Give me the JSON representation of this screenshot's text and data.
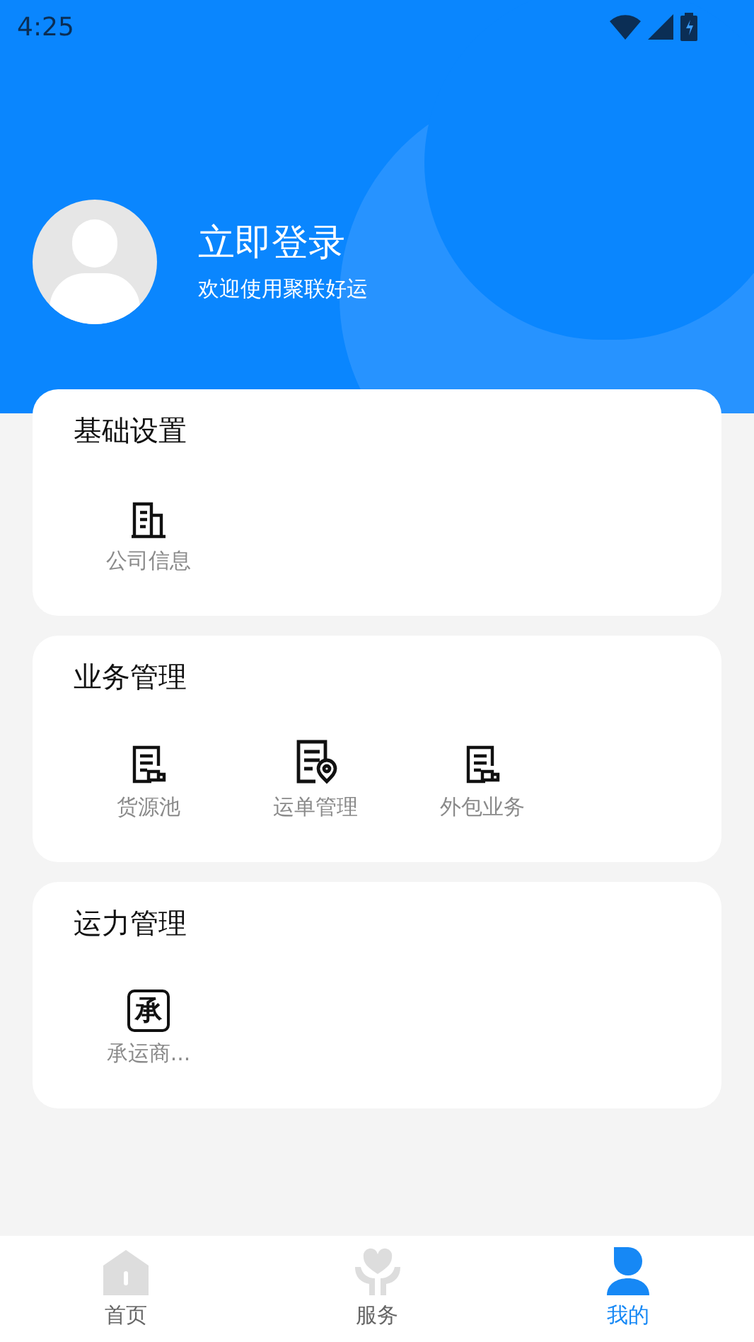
{
  "status_bar": {
    "time": "4:25"
  },
  "profile": {
    "title": "立即登录",
    "subtitle": "欢迎使用聚联好运"
  },
  "sections": [
    {
      "title": "基础设置",
      "items": [
        {
          "label": "公司信息",
          "kind": "building"
        }
      ]
    },
    {
      "title": "业务管理",
      "items": [
        {
          "label": "货源池",
          "kind": "doc-truck"
        },
        {
          "label": "运单管理",
          "kind": "doc-pin"
        },
        {
          "label": "外包业务",
          "kind": "doc-truck"
        }
      ]
    },
    {
      "title": "运力管理",
      "items": [
        {
          "label": "承运商...",
          "kind": "glyph",
          "glyph": "承"
        }
      ]
    }
  ],
  "tabs": [
    {
      "label": "首页",
      "kind": "home",
      "selected": false
    },
    {
      "label": "服务",
      "kind": "service",
      "selected": false
    },
    {
      "label": "我的",
      "kind": "user",
      "selected": true
    }
  ]
}
